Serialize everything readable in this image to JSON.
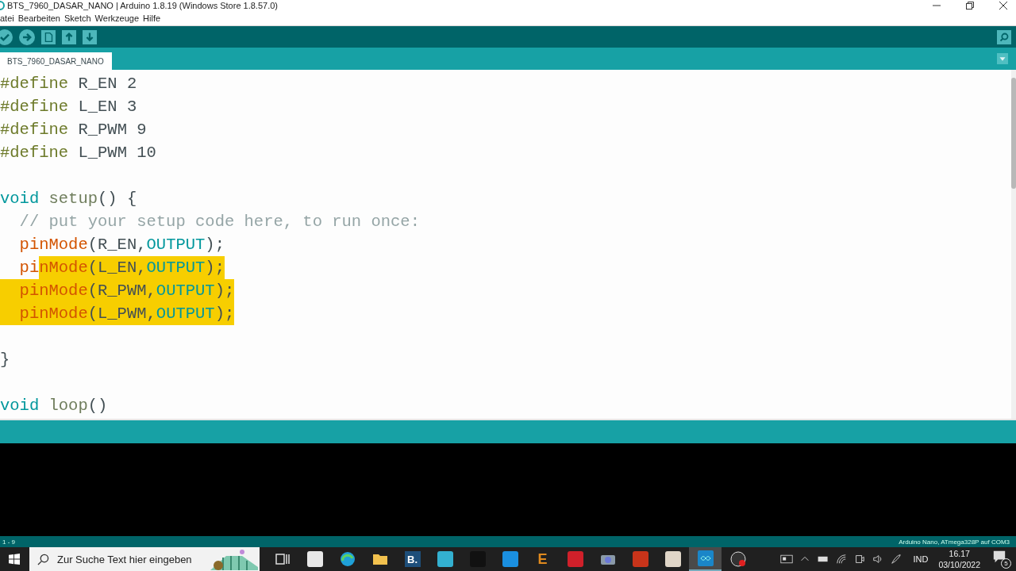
{
  "window": {
    "title": "BTS_7960_DASAR_NANO | Arduino 1.8.19 (Windows Store 1.8.57.0)"
  },
  "menu": [
    "atei",
    "Bearbeiten",
    "Sketch",
    "Werkzeuge",
    "Hilfe"
  ],
  "tabs": [
    {
      "label": "BTS_7960_DASAR_NANO",
      "selected": true
    }
  ],
  "editor": {
    "lines": [
      {
        "kind": "code",
        "tokens": [
          {
            "text": "#define",
            "kind": "directive",
            "selected": false
          },
          {
            "text": " R_EN 2",
            "kind": "plain",
            "selected": false
          }
        ]
      },
      {
        "kind": "code",
        "tokens": [
          {
            "text": "#define",
            "kind": "directive",
            "selected": false
          },
          {
            "text": " L_EN 3",
            "kind": "plain",
            "selected": false
          }
        ]
      },
      {
        "kind": "code",
        "tokens": [
          {
            "text": "#define",
            "kind": "directive",
            "selected": false
          },
          {
            "text": " R_PWM 9",
            "kind": "plain",
            "selected": false
          }
        ]
      },
      {
        "kind": "code",
        "tokens": [
          {
            "text": "#define",
            "kind": "directive",
            "selected": false
          },
          {
            "text": " L_PWM 10",
            "kind": "plain",
            "selected": false
          }
        ]
      },
      {
        "kind": "blank"
      },
      {
        "kind": "code",
        "tokens": [
          {
            "text": "void ",
            "kind": "type",
            "selected": false
          },
          {
            "text": "setup",
            "kind": "func",
            "selected": false
          },
          {
            "text": "() {",
            "kind": "plain",
            "selected": false
          }
        ]
      },
      {
        "kind": "code",
        "indented": true,
        "indent_selected": false,
        "tokens": [
          {
            "text": "// put your setup code here, to run once:",
            "kind": "comment",
            "selected": false
          }
        ]
      },
      {
        "kind": "code",
        "indented": true,
        "indent_selected": false,
        "tokens": [
          {
            "text": "pinMode",
            "kind": "method",
            "selected": false
          },
          {
            "text": "(R_EN,",
            "kind": "plain",
            "selected": false
          },
          {
            "text": "OUTPUT",
            "kind": "const",
            "selected": false
          },
          {
            "text": ");",
            "kind": "plain",
            "selected": false
          }
        ]
      },
      {
        "kind": "code",
        "indented": true,
        "indent_selected": false,
        "tokens": [
          {
            "text": "pi",
            "kind": "method",
            "selected": false
          },
          {
            "text": "nMode",
            "kind": "method",
            "selected": true
          },
          {
            "text": "(L_EN,",
            "kind": "plain",
            "selected": true
          },
          {
            "text": "OUTPUT",
            "kind": "const",
            "selected": true
          },
          {
            "text": ");",
            "kind": "plain",
            "selected": true
          }
        ]
      },
      {
        "kind": "code",
        "indented": true,
        "indent_selected": true,
        "tokens": [
          {
            "text": "pinMode",
            "kind": "method",
            "selected": true
          },
          {
            "text": "(R_PWM,",
            "kind": "plain",
            "selected": true
          },
          {
            "text": "OUTPUT",
            "kind": "const",
            "selected": true
          },
          {
            "text": ");",
            "kind": "plain",
            "selected": true
          }
        ]
      },
      {
        "kind": "code",
        "indented": true,
        "indent_selected": true,
        "tokens": [
          {
            "text": "pinMode",
            "kind": "method",
            "selected": true
          },
          {
            "text": "(L_PWM,",
            "kind": "plain",
            "selected": true
          },
          {
            "text": "OUTPUT",
            "kind": "const",
            "selected": true
          },
          {
            "text": ");",
            "kind": "plain",
            "selected": true
          }
        ]
      },
      {
        "kind": "blank"
      },
      {
        "kind": "code",
        "tokens": [
          {
            "text": "}",
            "kind": "plain",
            "selected": false
          }
        ]
      },
      {
        "kind": "blank"
      },
      {
        "kind": "code",
        "tokens": [
          {
            "text": "void ",
            "kind": "type",
            "selected": false
          },
          {
            "text": "loop",
            "kind": "func",
            "selected": false
          },
          {
            "text": "()",
            "kind": "plain",
            "selected": false
          }
        ]
      }
    ]
  },
  "status_bar": {
    "line": "1 - 9",
    "board": "Arduino Nano, ATmega328P auf COM3"
  },
  "taskbar": {
    "search": {
      "placeholder": "Zur Suche Text hier eingeben"
    },
    "apps": [
      {
        "kind": "taskview",
        "active": false
      },
      {
        "kind": "store",
        "active": false
      },
      {
        "kind": "edge",
        "active": false
      },
      {
        "kind": "folder",
        "active": false
      },
      {
        "kind": "letter",
        "label": "B.",
        "active": false
      },
      {
        "kind": "bluebox",
        "active": false
      },
      {
        "kind": "netflix",
        "active": false
      },
      {
        "kind": "mail",
        "active": false
      },
      {
        "kind": "letter-e",
        "label": "E",
        "active": false
      },
      {
        "kind": "redbox",
        "active": false
      },
      {
        "kind": "camera",
        "active": false
      },
      {
        "kind": "office",
        "active": false
      },
      {
        "kind": "round",
        "active": false
      },
      {
        "kind": "arduino",
        "active": true
      },
      {
        "kind": "recorder",
        "active": false
      }
    ],
    "language": "IND",
    "time": "16.17",
    "date": "03/10/2022",
    "notifications": "5"
  }
}
